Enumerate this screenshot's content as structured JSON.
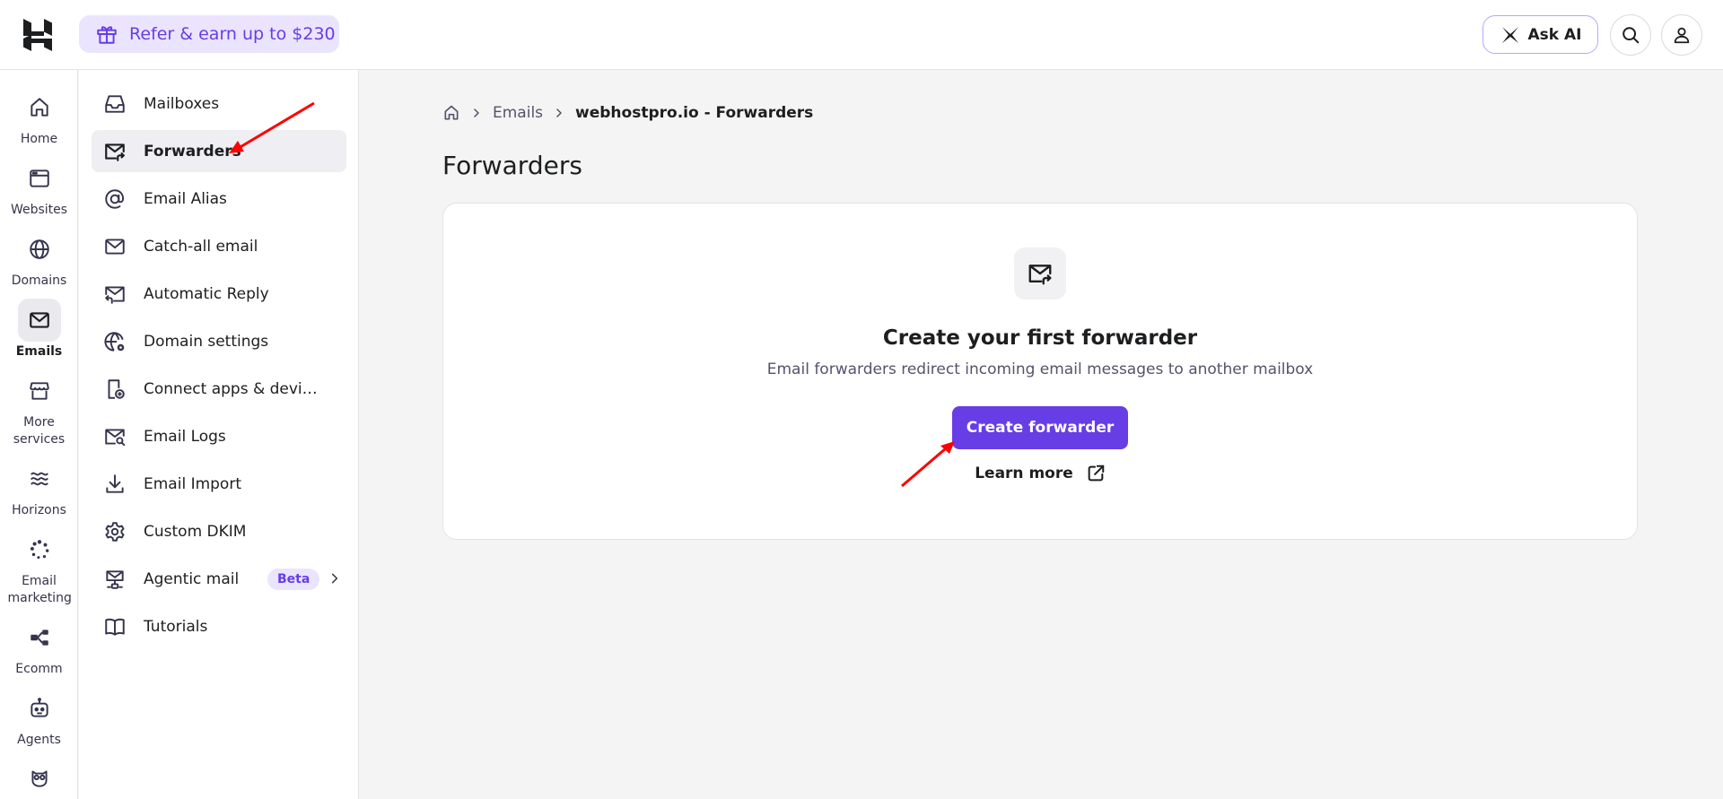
{
  "topbar": {
    "refer_label": "Refer & earn up to $230",
    "ask_ai_label": "Ask AI"
  },
  "rail": {
    "items": [
      {
        "label": "Home",
        "icon": "home-icon"
      },
      {
        "label": "Websites",
        "icon": "browser-icon"
      },
      {
        "label": "Domains",
        "icon": "globe-icon"
      },
      {
        "label": "Emails",
        "icon": "mail-icon",
        "active": true
      },
      {
        "label": "More services",
        "icon": "store-icon"
      },
      {
        "label": "Horizons",
        "icon": "horizons-icon"
      },
      {
        "label": "Email marketing",
        "icon": "email-marketing-icon"
      },
      {
        "label": "Ecomm",
        "icon": "ecomm-icon"
      },
      {
        "label": "Agents",
        "icon": "robot-icon"
      },
      {
        "label": "",
        "icon": "owl-icon"
      }
    ]
  },
  "sidebar": {
    "items": [
      {
        "label": "Mailboxes",
        "icon": "inbox-icon"
      },
      {
        "label": "Forwarders",
        "icon": "mail-forward-icon",
        "active": true
      },
      {
        "label": "Email Alias",
        "icon": "at-sign-icon"
      },
      {
        "label": "Catch-all email",
        "icon": "envelope-icon"
      },
      {
        "label": "Automatic Reply",
        "icon": "mail-reply-icon"
      },
      {
        "label": "Domain settings",
        "icon": "globe-settings-icon"
      },
      {
        "label": "Connect apps & devic...",
        "icon": "device-icon"
      },
      {
        "label": "Email Logs",
        "icon": "mail-search-icon"
      },
      {
        "label": "Email Import",
        "icon": "download-icon"
      },
      {
        "label": "Custom DKIM",
        "icon": "gear-icon"
      },
      {
        "label": "Agentic mail",
        "icon": "agentic-mail-icon",
        "badge": "Beta"
      },
      {
        "label": "Tutorials",
        "icon": "book-icon"
      }
    ]
  },
  "breadcrumb": {
    "parent": "Emails",
    "current": "webhostpro.io - Forwarders"
  },
  "main": {
    "title": "Forwarders",
    "empty_title": "Create your first forwarder",
    "empty_description": "Email forwarders redirect incoming email messages to another mailbox",
    "create_button": "Create forwarder",
    "learn_more": "Learn more"
  },
  "colors": {
    "accent": "#673de6",
    "accent_light": "#ebe4ff",
    "annotation": "#ff0000"
  }
}
